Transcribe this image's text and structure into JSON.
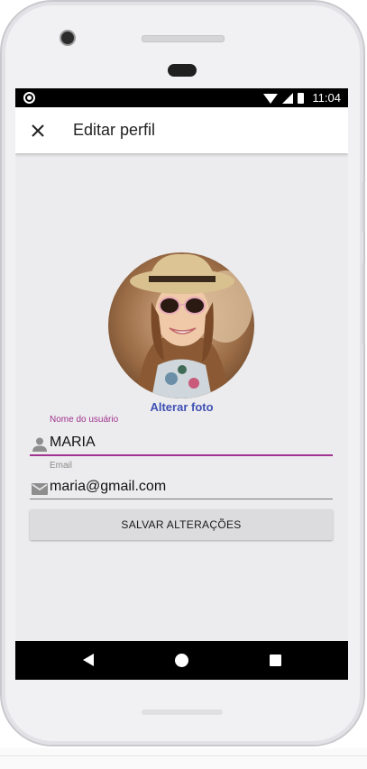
{
  "status_bar": {
    "time": "11:04"
  },
  "app_bar": {
    "title": "Editar perfil",
    "close_icon": "close-icon"
  },
  "profile": {
    "change_photo_label": "Alterar foto"
  },
  "form": {
    "username_label": "Nome do usuário",
    "username_value": "MARIA",
    "email_label": "Email",
    "email_value": "maria@gmail.com",
    "save_button_label": "SALVAR ALTERAÇÕES"
  },
  "nav_bar": {
    "items": [
      "back-icon",
      "home-icon",
      "recent-apps-icon"
    ]
  },
  "colors": {
    "accent": "#a0338f",
    "link": "#3f51b5",
    "screen_bg": "#ececee"
  }
}
